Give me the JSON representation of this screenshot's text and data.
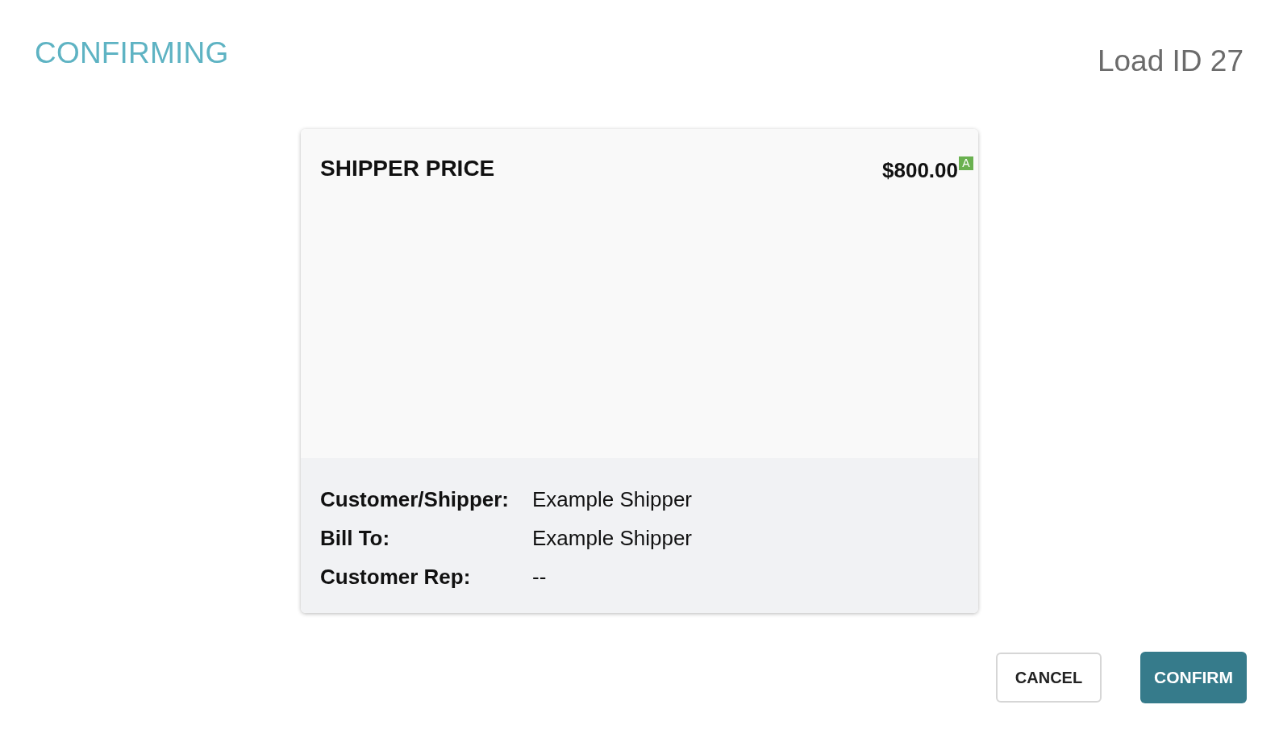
{
  "header": {
    "title": "CONFIRMING",
    "load_id": "Load ID 27"
  },
  "card": {
    "title": "SHIPPER PRICE",
    "price": "$800.00",
    "price_badge": "A",
    "details": [
      {
        "label": "Customer/Shipper:",
        "value": "Example Shipper"
      },
      {
        "label": "Bill To:",
        "value": "Example Shipper"
      },
      {
        "label": "Customer Rep:",
        "value": "--"
      }
    ]
  },
  "buttons": [
    {
      "label": "CANCEL",
      "kind": "secondary"
    },
    {
      "label": "CONFIRM",
      "kind": "primary"
    }
  ]
}
